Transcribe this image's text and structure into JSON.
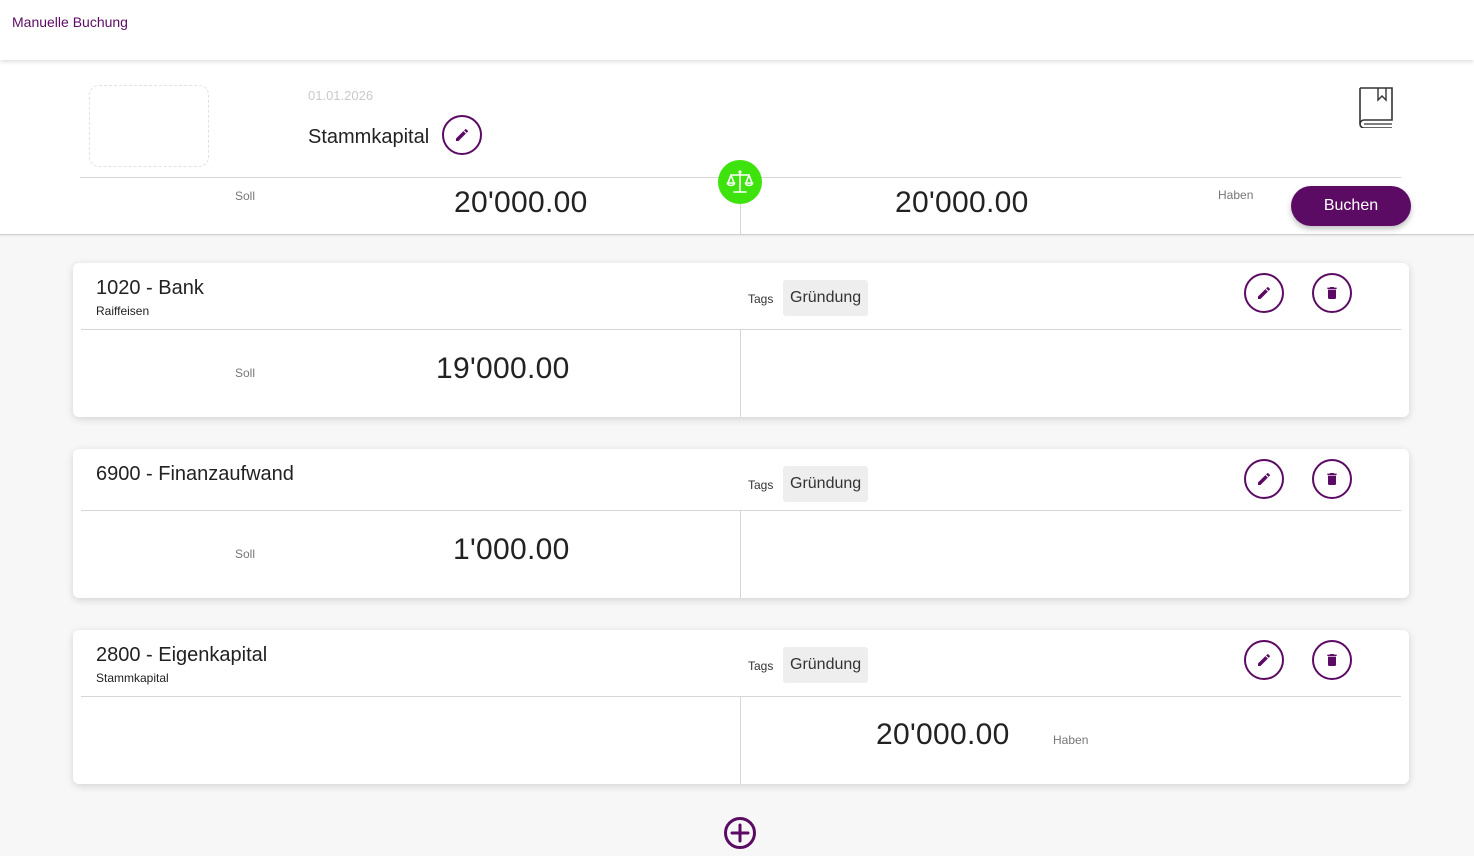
{
  "topbar": {
    "title": "Manuelle Buchung"
  },
  "header": {
    "date": "01.01.2026",
    "title": "Stammkapital",
    "soll_label": "Soll",
    "soll_total": "20'000.00",
    "haben_total": "20'000.00",
    "haben_label": "Haben",
    "book_button": "Buchen"
  },
  "colors": {
    "accent": "#5c0b64",
    "balanced": "#3ee20c"
  },
  "entries": [
    {
      "account": "1020 - Bank",
      "subtitle": "Raiffeisen",
      "tags_label": "Tags",
      "tag": "Gründung",
      "side_label": "Soll",
      "amount": "19'000.00"
    },
    {
      "account": "6900 - Finanzaufwand",
      "subtitle": "",
      "tags_label": "Tags",
      "tag": "Gründung",
      "side_label": "Soll",
      "amount": "1'000.00"
    },
    {
      "account": "2800 - Eigenkapital",
      "subtitle": "Stammkapital",
      "tags_label": "Tags",
      "tag": "Gründung",
      "side_label": "Haben",
      "amount": "20'000.00"
    }
  ],
  "icons": {
    "edit": "pencil-icon",
    "delete": "trash-icon",
    "balance": "scale-icon",
    "book": "book-icon",
    "add": "plus-circle-icon"
  }
}
